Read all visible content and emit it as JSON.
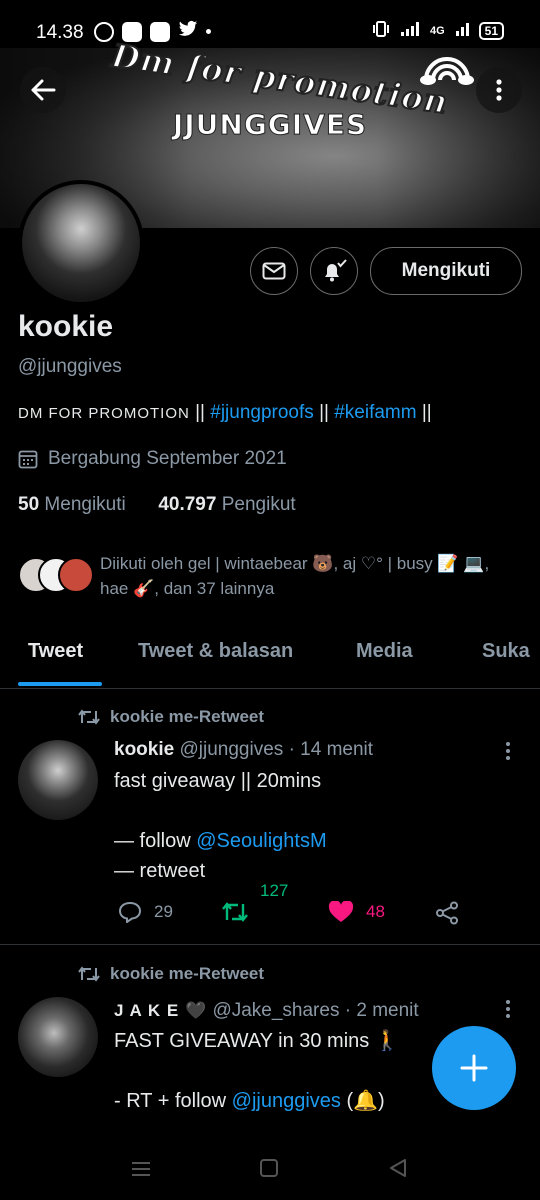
{
  "status_bar": {
    "time": "14.38",
    "battery": "51",
    "network": "4G"
  },
  "banner": {
    "title": "Dm for promotion",
    "subtitle": "JJUNGGIVES"
  },
  "profile": {
    "follow_label": "Mengikuti",
    "name": "kookie",
    "handle": "@jjunggives",
    "bio_prefix": "DM FOR PROMOTION",
    "bio_sep1": " || ",
    "bio_tag1": "#jjungproofs",
    "bio_sep2": " || ",
    "bio_tag2": "#keifamm",
    "bio_sep3": " ||",
    "joined": "Bergabung September 2021",
    "following_count": "50",
    "following_label": "Mengikuti",
    "followers_count": "40.797",
    "followers_label": "Pengikut",
    "followed_by": "Diikuti oleh gel | wintaebear 🐻, aj ♡° | busy 📝 💻, hae 🎸, dan 37 lainnya"
  },
  "tabs": [
    "Tweet",
    "Tweet & balasan",
    "Media",
    "Suka"
  ],
  "tweets": [
    {
      "retweeter": "kookie",
      "retweet_label": "me-Retweet",
      "name": "kookie",
      "handle": "@jjunggives",
      "time": "· 14 menit",
      "line1": "fast giveaway || 20mins",
      "line2_prefix": "— follow ",
      "line2_link": "@SeoulightsM",
      "line3": "— retweet",
      "replies": "29",
      "retweets": "127",
      "likes": "48"
    },
    {
      "retweeter": "kookie",
      "retweet_label": "me-Retweet",
      "name": "J A K E 🖤",
      "handle": "@Jake_shares",
      "time": "· 2 menit",
      "line1": "FAST GIVEAWAY in 30 mins 🚶",
      "line2_prefix": "- RT + follow ",
      "line2_link": "@jjunggives",
      "line2_suffix": " (🔔)"
    }
  ],
  "colors": {
    "accent": "#1d9bf0",
    "retweet": "#00ba7c",
    "like": "#f91880"
  }
}
